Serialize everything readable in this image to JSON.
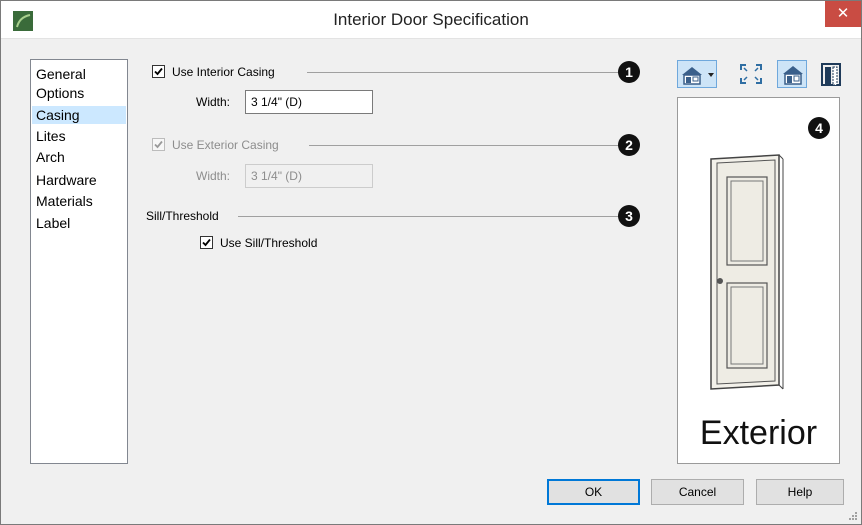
{
  "window": {
    "title": "Interior Door Specification",
    "close_glyph": "✕"
  },
  "nav": {
    "items": [
      {
        "label": "General"
      },
      {
        "label": "Options"
      },
      {
        "label": "Casing",
        "selected": true
      },
      {
        "label": "Lites"
      },
      {
        "label": "Arch"
      },
      {
        "label": "Hardware"
      },
      {
        "label": "Materials"
      },
      {
        "label": "Label"
      }
    ]
  },
  "casing": {
    "interior": {
      "label": "Use Interior Casing",
      "checked": true,
      "width_label": "Width:",
      "width_value": "3 1/4\" (D)"
    },
    "exterior": {
      "label": "Use Exterior Casing",
      "checked": true,
      "disabled": true,
      "width_label": "Width:",
      "width_value": "3 1/4\" (D)"
    }
  },
  "sill": {
    "heading": "Sill/Threshold",
    "label": "Use Sill/Threshold",
    "checked": true
  },
  "callouts": [
    "1",
    "2",
    "3",
    "4"
  ],
  "toolbar": {
    "icons": [
      "elevation-view-icon",
      "fill-window-icon",
      "camera-view-icon",
      "door-casing-icon"
    ]
  },
  "preview": {
    "label": "Exterior"
  },
  "buttons": {
    "ok": "OK",
    "cancel": "Cancel",
    "help": "Help"
  }
}
